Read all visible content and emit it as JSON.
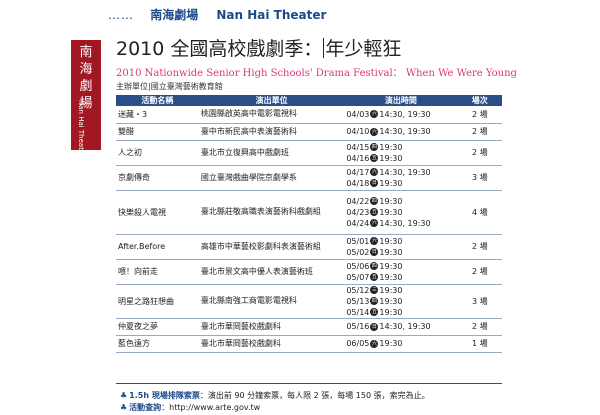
{
  "header": {
    "dots": "……",
    "venue_cn": "南海劇場",
    "venue_en": "Nan Hai Theater"
  },
  "logo": {
    "text_cn": "南海劇場",
    "text_en": "Nan Hai Theater",
    "color": "#a11822"
  },
  "title": {
    "main_left": "2010 全國高校戲劇季：",
    "main_right": "年少輕狂",
    "english": "2010 Nationwide Senior High Schools' Drama Festival： When We Were Young",
    "organizer": "主辦單位|國立臺灣藝術教育館"
  },
  "table": {
    "headers": [
      "活動名稱",
      "演出單位",
      "演出時間",
      "場次"
    ],
    "rows": [
      {
        "title": "迷藏・3",
        "unit": "桃園縣啟英高中電影電視科",
        "times": [
          {
            "date": "04/03",
            "day": "六",
            "time": "14:30, 19:30"
          }
        ],
        "count": "2 場"
      },
      {
        "title": "雙醋",
        "unit": "臺中市新民高中表演藝術科",
        "times": [
          {
            "date": "04/10",
            "day": "六",
            "time": "14:30, 19:30"
          }
        ],
        "count": "2 場"
      },
      {
        "title": "人之初",
        "unit": "臺北市立復興高中戲劇班",
        "times": [
          {
            "date": "04/15",
            "day": "四",
            "time": "19:30"
          },
          {
            "date": "04/16",
            "day": "五",
            "time": "19:30"
          }
        ],
        "count": "2 場"
      },
      {
        "title": "京劇傳奇",
        "unit": "國立臺灣戲曲學院京劇學系",
        "times": [
          {
            "date": "04/17",
            "day": "六",
            "time": "14:30, 19:30"
          },
          {
            "date": "04/18",
            "day": "日",
            "time": "19:30"
          }
        ],
        "count": "3 場"
      },
      {
        "title": "快樂殺人電視",
        "unit": "臺北縣莊敬高職表演藝術科戲劇組",
        "times": [
          {
            "date": "04/22",
            "day": "四",
            "time": "19:30"
          },
          {
            "date": "04/23",
            "day": "五",
            "time": "19:30"
          },
          {
            "date": "04/24",
            "day": "六",
            "time": "14:30, 19:30"
          }
        ],
        "count": "4 場"
      },
      {
        "title": "After.Before",
        "unit": "高雄市中華藝校影劇科表演藝術組",
        "times": [
          {
            "date": "05/01",
            "day": "六",
            "time": "19:30"
          },
          {
            "date": "05/02",
            "day": "日",
            "time": "19:30"
          }
        ],
        "count": "2 場"
      },
      {
        "title": "喂！向前走",
        "unit": "臺北市景文高中優人表演藝術班",
        "times": [
          {
            "date": "05/06",
            "day": "四",
            "time": "19:30"
          },
          {
            "date": "05/07",
            "day": "五",
            "time": "19:30"
          }
        ],
        "count": "2 場"
      },
      {
        "title": "明星之路狂想曲",
        "unit": "臺北縣南強工商電影電視科",
        "times": [
          {
            "date": "05/12",
            "day": "三",
            "time": "19:30"
          },
          {
            "date": "05/13",
            "day": "四",
            "time": "19:30"
          },
          {
            "date": "05/14",
            "day": "五",
            "time": "19:30"
          }
        ],
        "count": "3 場"
      },
      {
        "title": "仲夏夜之夢",
        "unit": "臺北市華岡藝校戲劇科",
        "times": [
          {
            "date": "05/16",
            "day": "日",
            "time": "14:30, 19:30"
          }
        ],
        "count": "2 場"
      },
      {
        "title": "藍色遠方",
        "unit": "臺北市華岡藝校戲劇科",
        "times": [
          {
            "date": "06/05",
            "day": "六",
            "time": "19:30"
          }
        ],
        "count": "1 場"
      }
    ]
  },
  "footer": {
    "ticket_label": "1.5h 現場排隊索票",
    "ticket_text": "：演出前 90 分鐘索票，每人限 2 張，每場 150 張，索完為止。",
    "site_label": "活動查詢",
    "site_text": "：http://www.arte.gov.tw"
  },
  "colors": {
    "header_blue": "#2a4e86",
    "subtitle_pink": "#d43a7d"
  }
}
